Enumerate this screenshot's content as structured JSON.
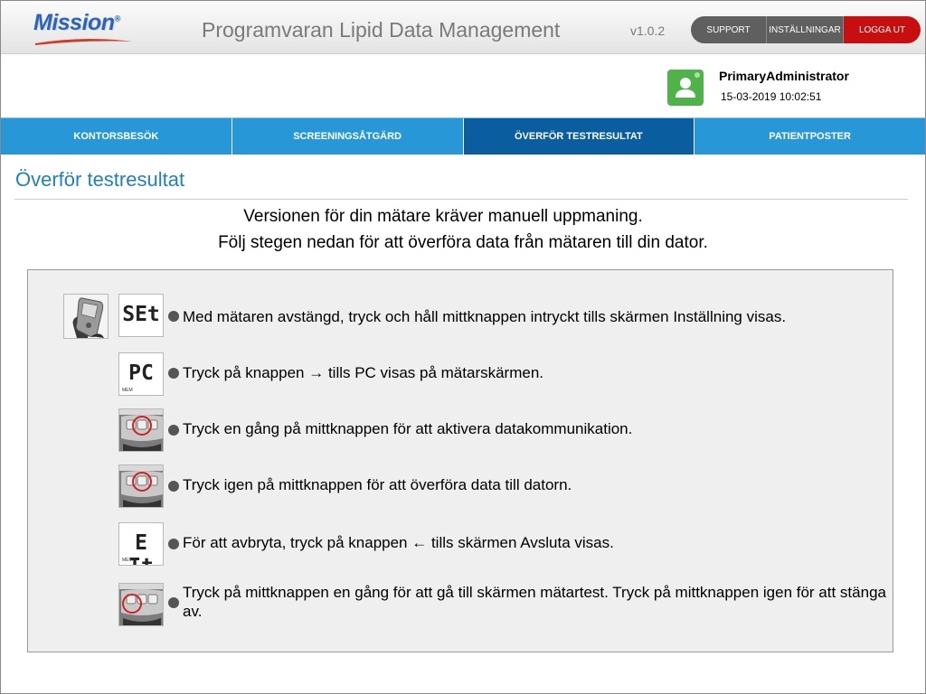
{
  "header": {
    "logo_text": "Mission",
    "logo_mark": "®",
    "app_title": "Programvaran Lipid Data Management",
    "version": "v1.0.2",
    "buttons": {
      "support": "SUPPORT",
      "settings": "INSTÄLLNINGAR",
      "logout": "LOGGA UT"
    },
    "logout_color": "#c80f0f"
  },
  "user": {
    "name": "PrimaryAdministrator",
    "datetime": "15-03-2019 10:02:51",
    "avatar_icon": "user-icon",
    "avatar_color": "#4fb34a"
  },
  "nav": {
    "tabs": [
      {
        "label": "KONTORSBESÖK",
        "active": false
      },
      {
        "label": "SCREENINGSÅTGÄRD",
        "active": false
      },
      {
        "label": "ÖVERFÖR TESTRESULTAT",
        "active": true
      },
      {
        "label": "PATIENTPOSTER",
        "active": false
      }
    ],
    "tab_color": "#2897d7",
    "active_color": "#0a5d9e"
  },
  "page": {
    "title": "Överför testresultat",
    "intro_line1": "Versionen för din mätare kräver manuell uppmaning.",
    "intro_line2": "Följ stegen nedan för att överföra data från mätaren till din dator."
  },
  "steps": [
    {
      "lcd": "SEt",
      "text": "Med mätaren avstängd, tryck och håll mittknappen intryckt tills skärmen Inställning visas.",
      "icon": "set-display-icon"
    },
    {
      "lcd": "PC",
      "lcd_sub": "MEM",
      "text": "Tryck på knappen → tills PC visas på mätarskärmen.",
      "icon": "pc-display-icon"
    },
    {
      "text": "Tryck en gång på mittknappen för att aktivera datakommunikation.",
      "icon": "meter-center-button-icon"
    },
    {
      "text": "Tryck igen på mittknappen för att överföra data till datorn.",
      "icon": "meter-center-button-icon"
    },
    {
      "lcd": "E It",
      "lcd_sub": "MEM",
      "text": "För att avbryta, tryck på knappen ← tills skärmen Avsluta visas.",
      "icon": "exit-display-icon"
    },
    {
      "text": "Tryck på mittknappen en gång för att gå till skärmen mätartest. Tryck på mittknappen igen för att stänga av.",
      "icon": "meter-left-button-icon"
    }
  ]
}
